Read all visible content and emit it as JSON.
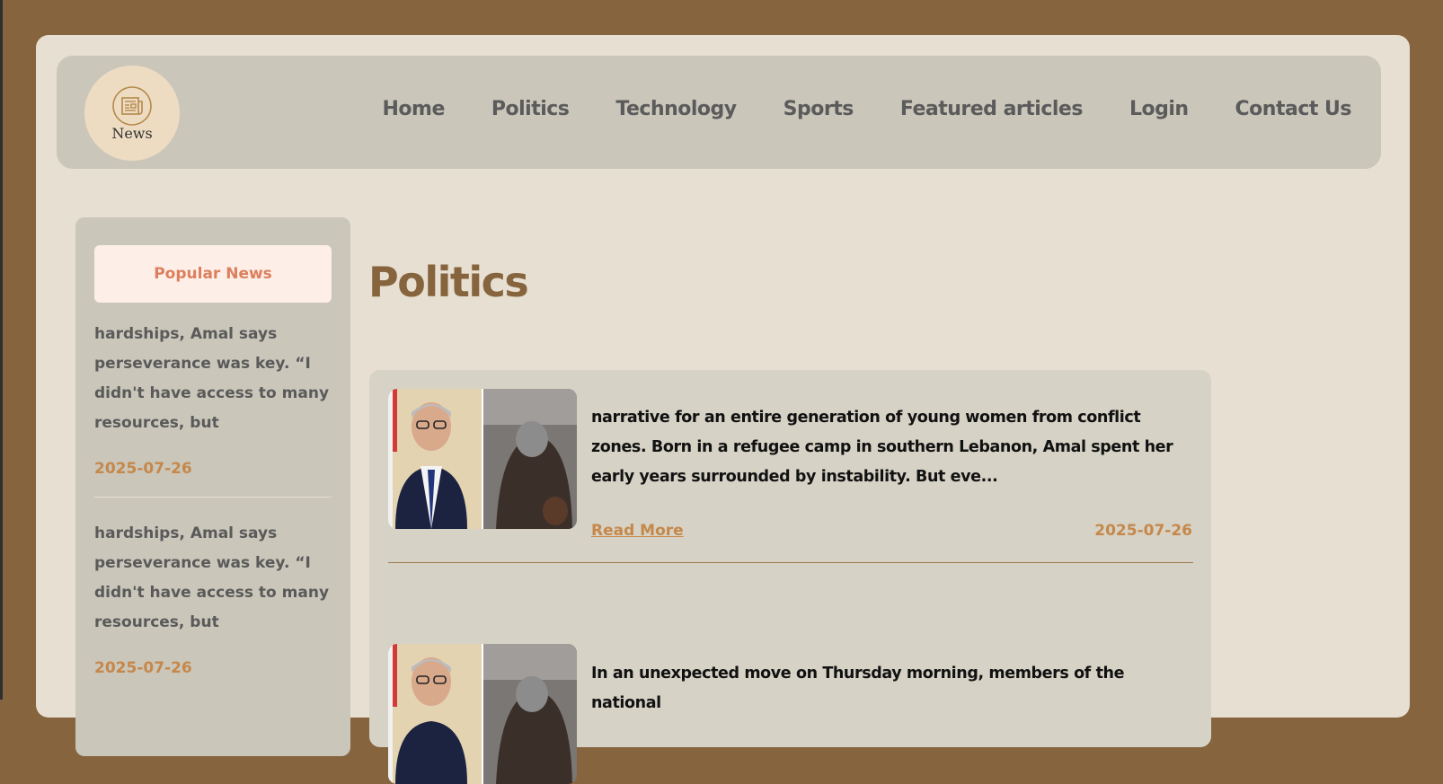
{
  "logo": {
    "text": "News"
  },
  "nav": [
    {
      "label": "Home"
    },
    {
      "label": "Politics"
    },
    {
      "label": "Technology"
    },
    {
      "label": "Sports"
    },
    {
      "label": "Featured articles"
    },
    {
      "label": "Login"
    },
    {
      "label": "Contact Us"
    }
  ],
  "sidebar": {
    "heading": "Popular News",
    "items": [
      {
        "text": "hardships, Amal says perseverance was key. “I didn't have access to many resources, but",
        "date": "2025-07-26"
      },
      {
        "text": "hardships, Amal says perseverance was key. “I didn't have access to many resources, but",
        "date": "2025-07-26"
      }
    ]
  },
  "main": {
    "title": "Politics",
    "articles": [
      {
        "excerpt": "narrative for an entire generation of young women from conflict zones. Born in a refugee camp in southern Lebanon, Amal spent her early years surrounded by instability. But eve...",
        "read_more": "Read More",
        "date": "2025-07-26"
      },
      {
        "excerpt": "In an unexpected move on Thursday morning, members of the national"
      }
    ]
  },
  "colors": {
    "frame": "#86643d",
    "page": "#e6dfd2",
    "panel": "#cac6ba",
    "accent": "#c5884a",
    "popular": "#dc7f5c"
  }
}
